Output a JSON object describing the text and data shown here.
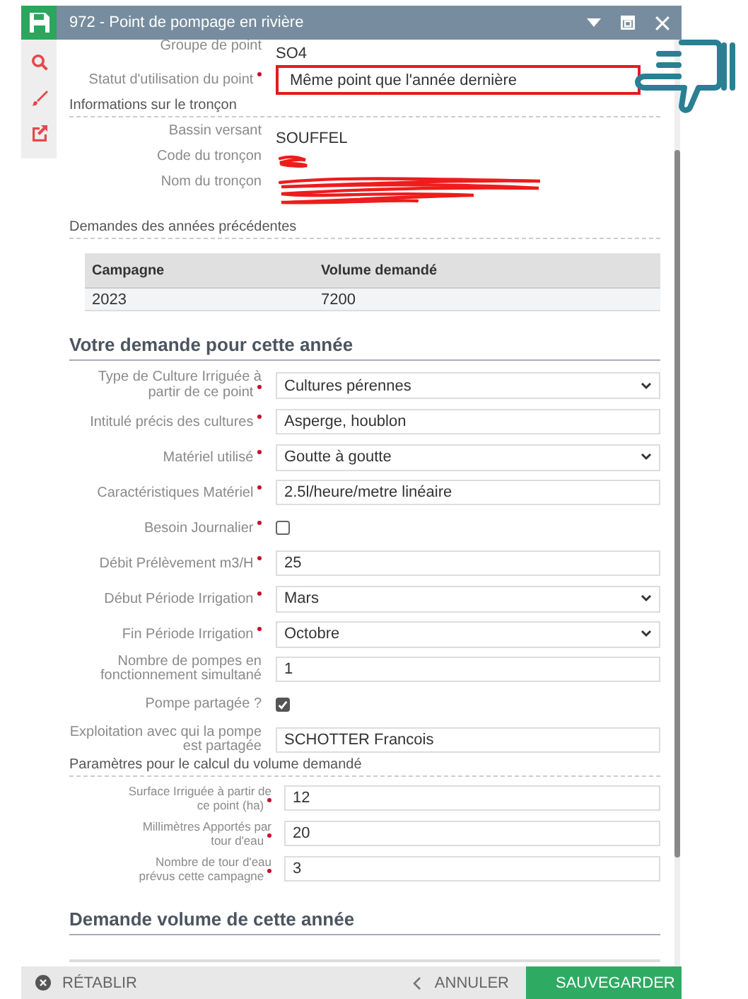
{
  "window": {
    "title": "972 - Point de pompage en rivière"
  },
  "top_rows": [
    {
      "kind": "static",
      "label": "Groupe de point",
      "value": "SO4"
    },
    {
      "kind": "input",
      "label": "Statut d'utilisation du point",
      "required": true,
      "value": "Même point que l'année dernière",
      "highlighted": true
    }
  ],
  "troncon": {
    "title": "Informations sur le tronçon",
    "rows": [
      {
        "kind": "static",
        "label": "Bassin versant",
        "value": "SOUFFEL"
      },
      {
        "kind": "redacted",
        "label": "Code du tronçon"
      },
      {
        "kind": "redacted_long",
        "label": "Nom du tronçon"
      }
    ]
  },
  "previous": {
    "title": "Demandes des années précédentes",
    "table": {
      "columns": [
        "Campagne",
        "Volume demandé"
      ],
      "rows": [
        [
          "2023",
          "7200"
        ]
      ]
    }
  },
  "request": {
    "title": "Votre demande pour cette année",
    "rows": [
      {
        "kind": "select",
        "label": "Type de Culture Irriguée à partir de ce point",
        "required": true,
        "value": "Cultures pérennes"
      },
      {
        "kind": "input",
        "label": "Intitulé précis des cultures",
        "required": true,
        "value": "Asperge, houblon"
      },
      {
        "kind": "select",
        "label": "Matériel utilisé",
        "required": true,
        "value": "Goutte à goutte"
      },
      {
        "kind": "input",
        "label": "Caractéristiques Matériel",
        "required": true,
        "value": "2.5l/heure/metre linéaire"
      },
      {
        "kind": "checkbox",
        "label": "Besoin Journalier",
        "required": true,
        "checked": false
      },
      {
        "kind": "input",
        "label": "Débit Prélèvement m3/H",
        "required": true,
        "value": "25"
      },
      {
        "kind": "select",
        "label": "Début Période Irrigation",
        "required": true,
        "value": "Mars"
      },
      {
        "kind": "select",
        "label": "Fin Période Irrigation",
        "required": true,
        "value": "Octobre"
      },
      {
        "kind": "input",
        "label": "Nombre de pompes en fonctionnement simultané",
        "required": false,
        "value": "1"
      },
      {
        "kind": "checkbox",
        "label": "Pompe partagée ?",
        "required": false,
        "checked": true
      },
      {
        "kind": "input",
        "label": "Exploitation avec qui la pompe est partagée",
        "required": false,
        "value": "SCHOTTER Francois"
      }
    ]
  },
  "params": {
    "title": "Paramètres pour le calcul du volume demandé",
    "rows": [
      {
        "kind": "input",
        "label": "Surface Irriguée à partir de ce point (ha)",
        "required": true,
        "value": "12"
      },
      {
        "kind": "input",
        "label": "Millimètres Apportés par tour d'eau",
        "required": true,
        "value": "20"
      },
      {
        "kind": "input",
        "label": "Nombre de tour d'eau prévus cette campagne",
        "required": true,
        "value": "3"
      }
    ]
  },
  "volume": {
    "title": "Demande volume de cette année"
  },
  "footer": {
    "reset": "RÉTABLIR",
    "cancel": "ANNULER",
    "save": "SAUVEGARDER"
  }
}
